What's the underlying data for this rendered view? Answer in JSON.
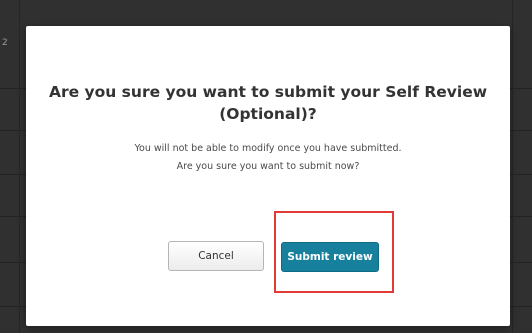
{
  "background": {
    "edge_text": "2"
  },
  "dialog": {
    "title": "Are you sure you want to submit your Self Review (Optional)?",
    "message_line1": "You will not be able to modify once you have submitted.",
    "message_line2": "Are you sure you want to submit now?",
    "cancel_label": "Cancel",
    "submit_label": "Submit review"
  },
  "colors": {
    "submit_button": "#17819d",
    "highlight": "#e03b35",
    "overlay": "#303030"
  }
}
